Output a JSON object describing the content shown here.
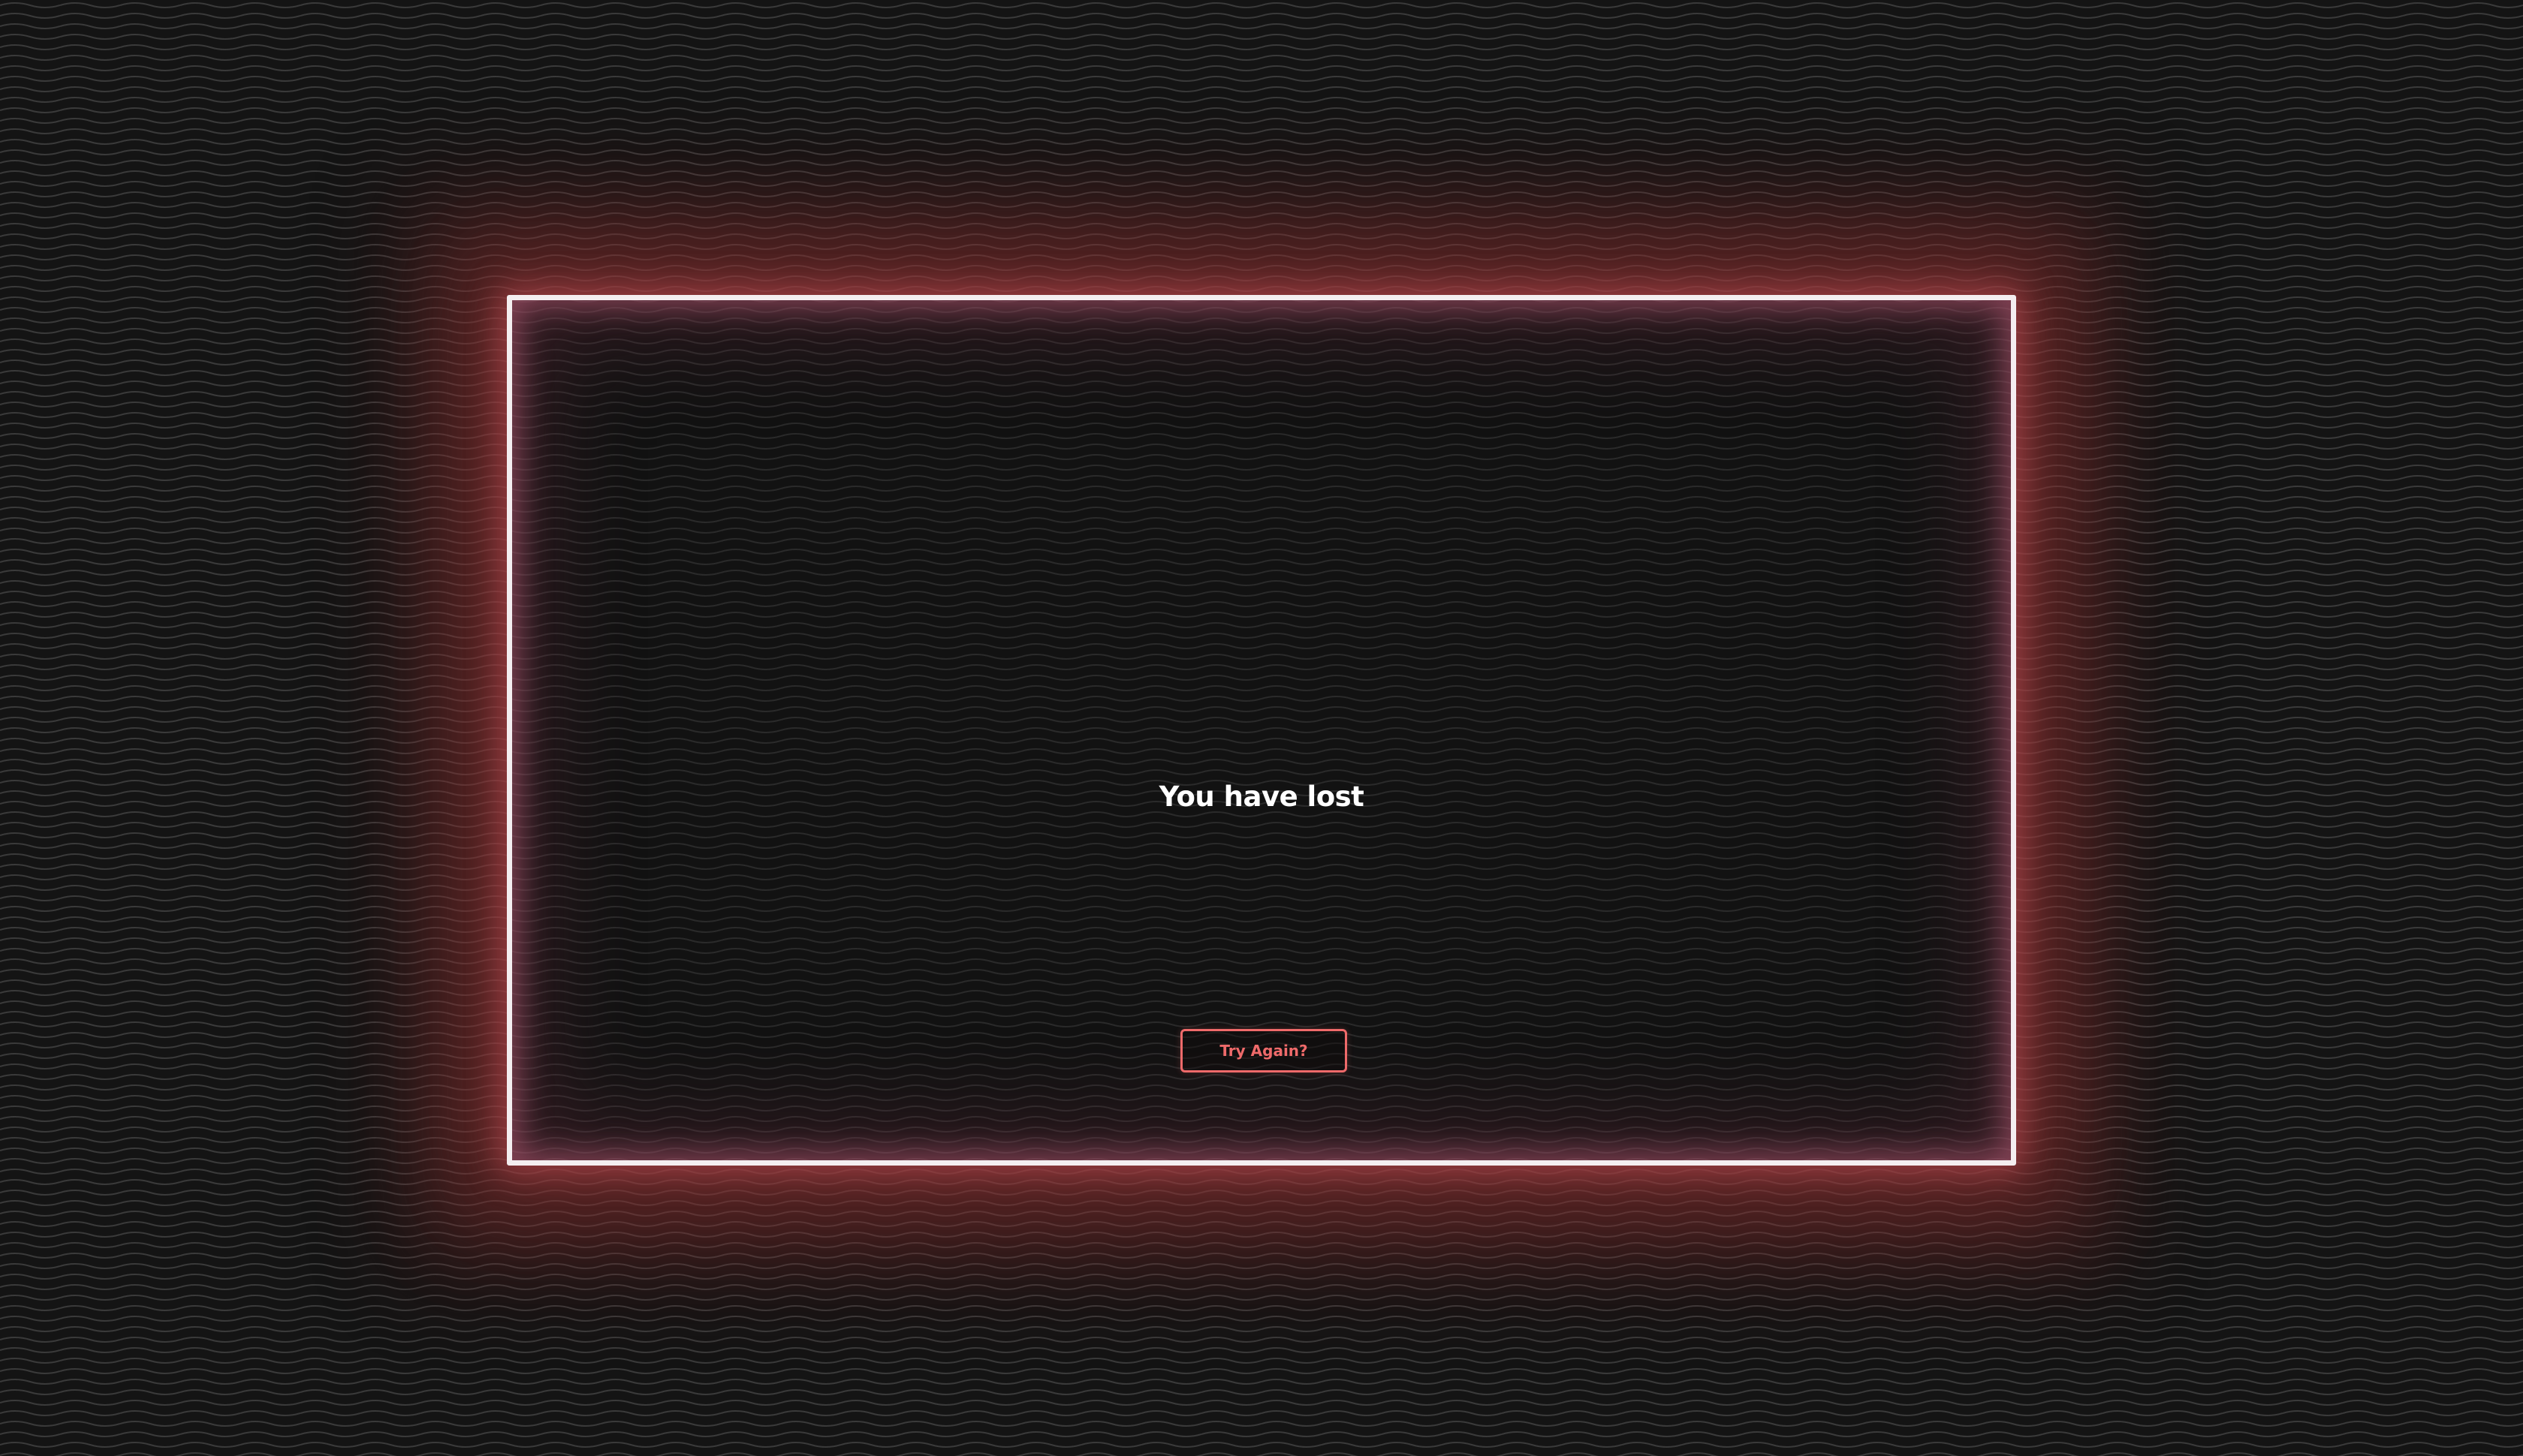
{
  "game": {
    "status_message": "You have lost",
    "retry_button_label": "Try Again?"
  },
  "colors": {
    "background": "#151515",
    "frame_border": "#f4eef0",
    "frame_glow": "#c8505a",
    "button_accent": "#ef6a6a",
    "text": "#ffffff"
  }
}
